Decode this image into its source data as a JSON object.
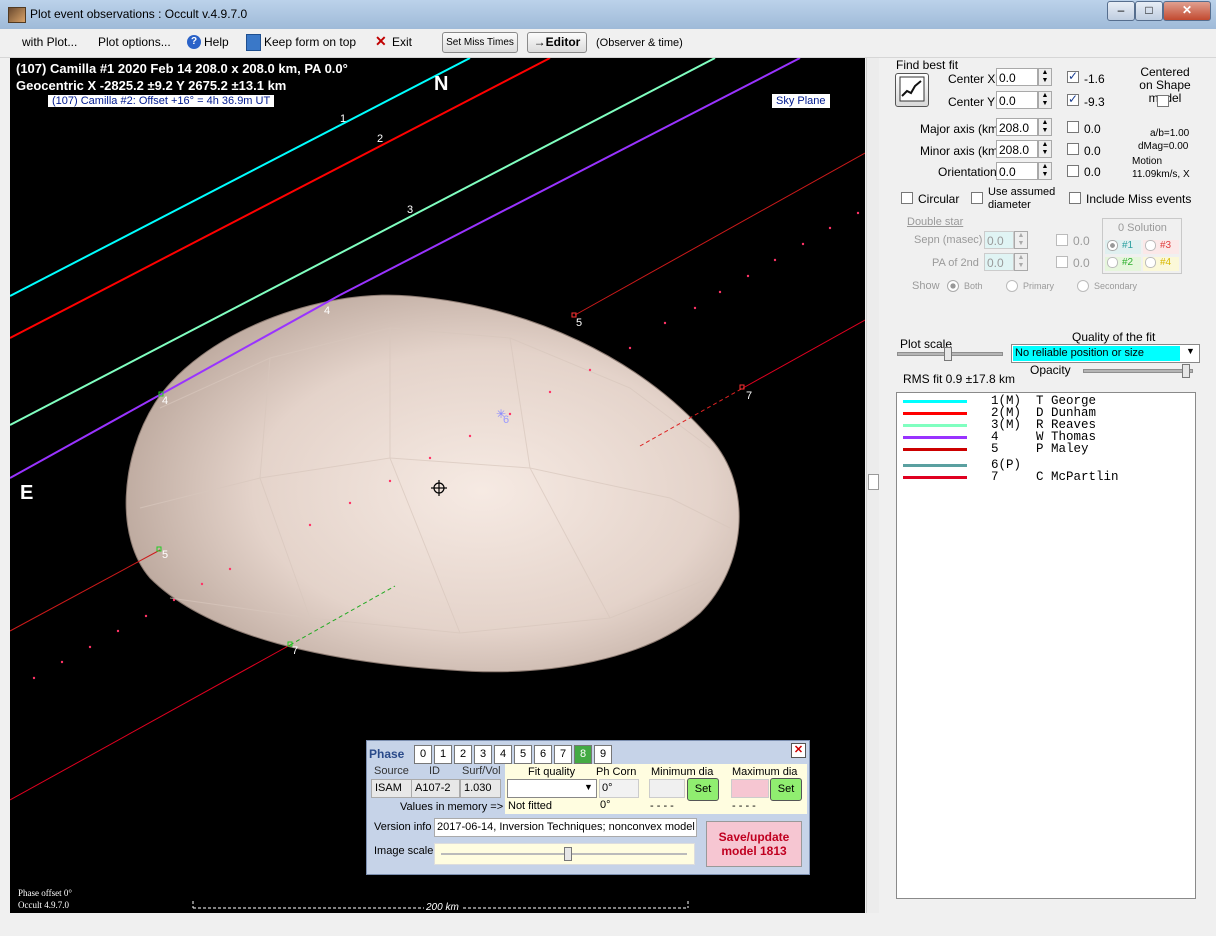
{
  "window": {
    "title": "Plot event observations : Occult v.4.9.7.0",
    "min": "–",
    "max": "□",
    "close": "✕"
  },
  "menu": {
    "with_plot": "with Plot...",
    "plot_options": "Plot options...",
    "help": "Help",
    "keep_on_top": "Keep form on top",
    "exit": "Exit",
    "set_miss_times": "Set Miss Times",
    "editor": "→Editor",
    "observer_time": "(Observer & time)"
  },
  "plot": {
    "line1": "(107) Camilla #1  2020 Feb 14   208.0 x 208.0 km,  PA 0.0°",
    "line2": "Geocentric  X  -2825.2 ±9.2  Y 2675.2 ±13.1 km",
    "offset_label": "(107) Camilla #2: Offset +16° =  4h 36.9m UT",
    "north": "N",
    "east": "E",
    "sky_plane": "Sky Plane",
    "phase_offset": "Phase offset 0°",
    "version": "Occult 4.9.7.0",
    "scale_label": "200 km",
    "chord_labels": [
      "1",
      "2",
      "3",
      "4",
      "4",
      "5",
      "5",
      "7",
      "7",
      "6"
    ]
  },
  "fit": {
    "find_best_fit": "Find best fit",
    "center_x_label": "Center X",
    "center_x": "0.0",
    "center_x_res": "-1.6",
    "center_y_label": "Center Y",
    "center_y": "0.0",
    "center_y_res": "-9.3",
    "centered_on": "Centered on Shape model",
    "major_label": "Major axis (km)",
    "major": "208.0",
    "major_res": "0.0",
    "minor_label": "Minor axis (km)",
    "minor": "208.0",
    "minor_res": "0.0",
    "orient_label": "Orientation",
    "orient": "0.0",
    "orient_res": "0.0",
    "ab": "a/b=1.00",
    "dmag": "dMag=0.00",
    "motion_label": "Motion",
    "motion": "11.09km/s, X",
    "circular": "Circular",
    "use_assumed": "Use assumed diameter",
    "include_miss": "Include Miss events",
    "double_star": "Double star",
    "sepn_label": "Sepn (masec)",
    "sepn": "0.0",
    "sepn_res": "0.0",
    "pa2_label": "PA of 2nd",
    "pa2": "0.0",
    "pa2_res": "0.0",
    "show_label": "Show",
    "show_both": "Both",
    "show_primary": "Primary",
    "show_secondary": "Secondary",
    "solution_label": "0 Solution",
    "sol1": "#1",
    "sol2": "#2",
    "sol3": "#3",
    "sol4": "#4",
    "plot_scale": "Plot scale",
    "quality_label": "Quality of the fit",
    "quality_value": "No reliable position or size",
    "opacity": "Opacity",
    "rms": "RMS fit 0.9 ±17.8 km"
  },
  "observers": [
    {
      "text": "1(M)  T George",
      "color": "#00ffff"
    },
    {
      "text": "2(M)  D Dunham",
      "color": "#ff0000"
    },
    {
      "text": "3(M)  R Reaves",
      "color": "#80ffc0"
    },
    {
      "text": "4     W Thomas",
      "color": "#9933ff"
    },
    {
      "text": "5     P Maley",
      "color": "#cc0000"
    },
    {
      "text": "6(P)",
      "color": "#5aa0a0"
    },
    {
      "text": "7     C McPartlin",
      "color": "#e00020"
    }
  ],
  "phase": {
    "title": "Phase",
    "buttons": [
      "0",
      "1",
      "2",
      "3",
      "4",
      "5",
      "6",
      "7",
      "8",
      "9"
    ],
    "selected": "8",
    "source_h": "Source",
    "id_h": "ID",
    "surf_h": "Surf/Vol",
    "source": "ISAM",
    "id": "A107-2",
    "surf": "1.030",
    "fit_quality_h": "Fit quality",
    "ph_corn_h": "Ph Corn",
    "min_dia_h": "Minimum dia",
    "max_dia_h": "Maximum dia",
    "ph_corn": "0°",
    "values_memory": "Values in memory =>",
    "not_fitted": "Not fitted",
    "ph_val": "0°",
    "dash1": "- - - -",
    "dash2": "- - - -",
    "set": "Set",
    "version_label": "Version info",
    "version_value": "2017-06-14, Inversion Techniques; nonconvex model",
    "image_scale": "Image scale",
    "save_btn": "Save/update model 1813"
  }
}
